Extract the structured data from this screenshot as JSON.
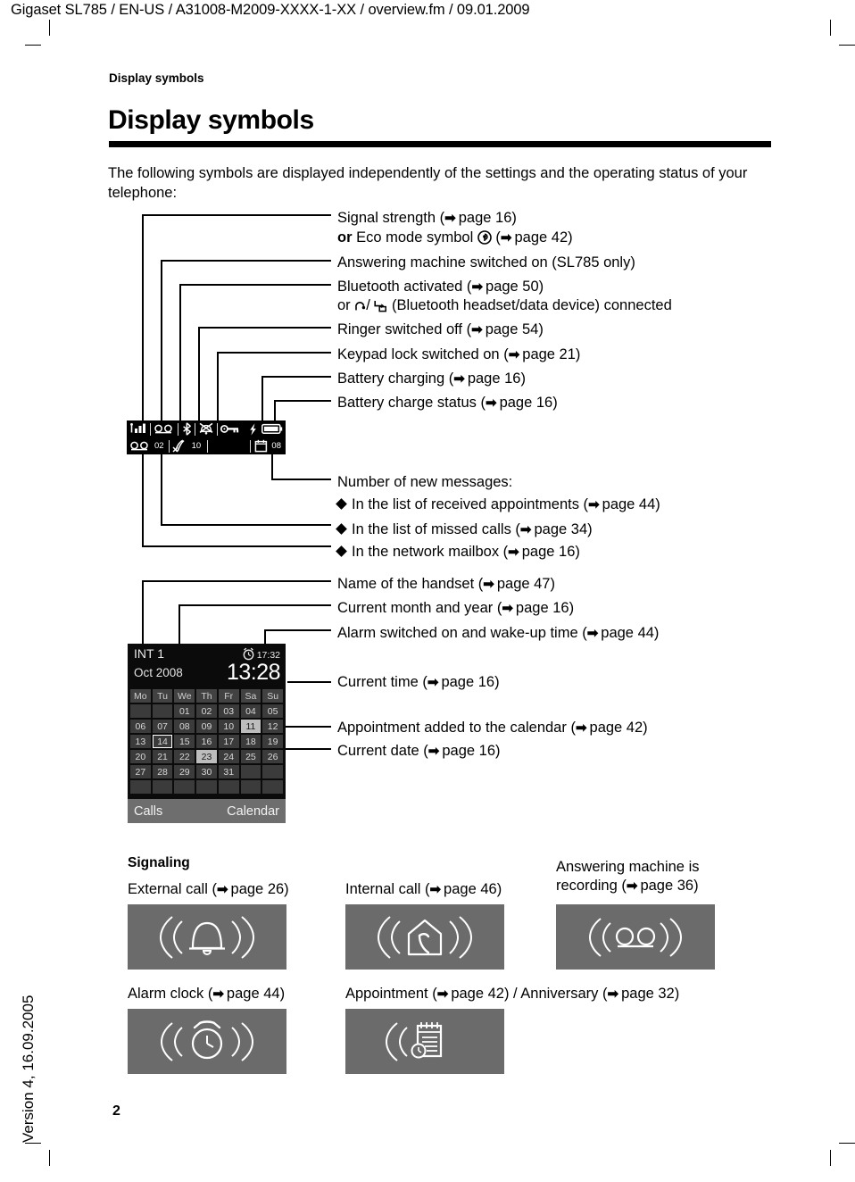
{
  "header": {
    "running_head": "Gigaset SL785 / EN-US / A31008-M2009-XXXX-1-XX / overview.fm / 09.01.2009",
    "section_label": "Display symbols",
    "chapter_title": "Display symbols",
    "intro": "The following symbols are displayed independently of the settings and the operating status of your telephone:"
  },
  "callouts": {
    "signal_strength": "Signal strength (",
    "signal_strength_ref": "page 16)",
    "eco_or": "or",
    "eco_mode": "Eco mode symbol",
    "eco_ref": "page 42)",
    "answering_machine": "Answering machine switched on (SL785 only)",
    "bluetooth": "Bluetooth activated (",
    "bluetooth_ref": "page 50)",
    "bluetooth_or": "or",
    "bluetooth_tail": "(Bluetooth headset/data device) connected",
    "ringer_off": "Ringer switched off (",
    "ringer_off_ref": "page 54)",
    "keypad_lock": "Keypad lock switched on (",
    "keypad_lock_ref": "page 21)",
    "battery_charging": "Battery charging (",
    "battery_charging_ref": "page 16)",
    "battery_status": "Battery charge status (",
    "battery_status_ref": "page 16)",
    "new_messages_head": "Number of new messages:",
    "msg_appointments": "In the list of received appointments (",
    "msg_appointments_ref": "page 44)",
    "msg_missed": "In the list of missed calls (",
    "msg_missed_ref": "page 34)",
    "msg_mailbox": "In the network mailbox (",
    "msg_mailbox_ref": "page 16)",
    "handset_name": "Name of the handset (",
    "handset_name_ref": "page 47)",
    "month_year": "Current month and year (",
    "month_year_ref": "page 16)",
    "alarm_on": "Alarm switched on and wake-up time (",
    "alarm_on_ref": "page 44)",
    "current_time": "Current time (",
    "current_time_ref": "page 16)",
    "appt_added": "Appointment added to the calendar (",
    "appt_added_ref": "page 42)",
    "current_date": "Current date (",
    "current_date_ref": "page 16)"
  },
  "statusbar": {
    "icons_top": [
      "signal-strength-icon",
      "answering-machine-icon",
      "bluetooth-icon",
      "ringer-off-icon",
      "keypad-lock-icon",
      "charging-bolt-icon",
      "battery-icon"
    ],
    "mailbox_count": "02",
    "missed_calls_count": "10",
    "appointments_count": "08"
  },
  "display": {
    "handset_name": "INT 1",
    "alarm_time": "17:32",
    "month_year": "Oct 2008",
    "time": "13:28",
    "weekdays": [
      "Mo",
      "Tu",
      "We",
      "Th",
      "Fr",
      "Sa",
      "Su"
    ],
    "days": [
      {
        "label": "",
        "state": "empty"
      },
      {
        "label": "",
        "state": "empty"
      },
      {
        "label": "01",
        "state": "normal"
      },
      {
        "label": "02",
        "state": "normal"
      },
      {
        "label": "03",
        "state": "normal"
      },
      {
        "label": "04",
        "state": "normal"
      },
      {
        "label": "05",
        "state": "normal"
      },
      {
        "label": "06",
        "state": "normal"
      },
      {
        "label": "07",
        "state": "normal"
      },
      {
        "label": "08",
        "state": "normal"
      },
      {
        "label": "09",
        "state": "normal"
      },
      {
        "label": "10",
        "state": "normal"
      },
      {
        "label": "11",
        "state": "appt"
      },
      {
        "label": "12",
        "state": "normal"
      },
      {
        "label": "13",
        "state": "normal"
      },
      {
        "label": "14",
        "state": "today"
      },
      {
        "label": "15",
        "state": "normal"
      },
      {
        "label": "16",
        "state": "normal"
      },
      {
        "label": "17",
        "state": "normal"
      },
      {
        "label": "18",
        "state": "normal"
      },
      {
        "label": "19",
        "state": "normal"
      },
      {
        "label": "20",
        "state": "normal"
      },
      {
        "label": "21",
        "state": "normal"
      },
      {
        "label": "22",
        "state": "normal"
      },
      {
        "label": "23",
        "state": "appt"
      },
      {
        "label": "24",
        "state": "normal"
      },
      {
        "label": "25",
        "state": "normal"
      },
      {
        "label": "26",
        "state": "normal"
      },
      {
        "label": "27",
        "state": "normal"
      },
      {
        "label": "28",
        "state": "normal"
      },
      {
        "label": "29",
        "state": "normal"
      },
      {
        "label": "30",
        "state": "normal"
      },
      {
        "label": "31",
        "state": "normal"
      },
      {
        "label": "",
        "state": "empty"
      },
      {
        "label": "",
        "state": "empty"
      },
      {
        "label": "",
        "state": "empty"
      },
      {
        "label": "",
        "state": "empty"
      },
      {
        "label": "",
        "state": "empty"
      },
      {
        "label": "",
        "state": "empty"
      },
      {
        "label": "",
        "state": "empty"
      },
      {
        "label": "",
        "state": "empty"
      },
      {
        "label": "",
        "state": "empty"
      }
    ],
    "softkey_left": "Calls",
    "softkey_right": "Calendar"
  },
  "signaling": {
    "heading": "Signaling",
    "external_call": "External call (",
    "external_call_ref": "page 26)",
    "internal_call": "Internal call (",
    "internal_call_ref": "page 46)",
    "answering_rec_l1": "Answering machine is",
    "answering_rec_l2": "recording (",
    "answering_rec_ref": "page 36)",
    "alarm_clock": "Alarm clock (",
    "alarm_clock_ref": "page 44)",
    "appointment": "Appointment (",
    "appointment_ref": "page 42)",
    "anniversary_sep": "/ Anniversary (",
    "anniversary_ref": "page 32)"
  },
  "footer": {
    "page_number": "2",
    "side_version": "Version 4, 16.09.2005"
  },
  "colors": {
    "ink": "#000000",
    "paper": "#ffffff",
    "display_bg": "#0b0b0b",
    "cell_bg": "#3b3b3b",
    "cell_appt": "#bdbdbd",
    "softkey_bg": "#6e6e6e",
    "sig_box": "#6b6b6b"
  }
}
